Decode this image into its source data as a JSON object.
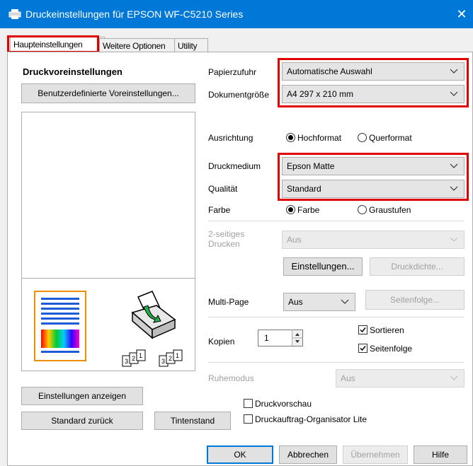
{
  "window": {
    "title": "Druckeinstellungen für EPSON WF-C5210 Series",
    "close_glyph": "✕"
  },
  "tabs": [
    {
      "label": "Haupteinstellungen"
    },
    {
      "label": "Weitere Optionen"
    },
    {
      "label": "Utility"
    }
  ],
  "left": {
    "presets_heading": "Druckvoreinstellungen",
    "custom_presets_button": "Benutzerdefinierte Voreinstellungen...",
    "show_settings_button": "Einstellungen anzeigen",
    "reset_button": "Standard zurück",
    "ink_button": "Tintenstand",
    "page_order_glyphs": [
      "1",
      "2",
      "3"
    ]
  },
  "form": {
    "paper_source": {
      "label": "Papierzufuhr",
      "value": "Automatische Auswahl"
    },
    "document_size": {
      "label": "Dokumentgröße",
      "value": "A4 297 x 210 mm"
    },
    "orientation": {
      "label": "Ausrichtung",
      "options": [
        "Hochformat",
        "Querformat"
      ],
      "selected": "Hochformat"
    },
    "media": {
      "label": "Druckmedium",
      "value": "Epson Matte"
    },
    "quality": {
      "label": "Qualität",
      "value": "Standard"
    },
    "color": {
      "label": "Farbe",
      "options": [
        "Farbe",
        "Graustufen"
      ],
      "selected": "Farbe"
    },
    "duplex": {
      "label_line1": "2-seitiges",
      "label_line2": "Drucken",
      "value": "Aus"
    },
    "settings_button": "Einstellungen...",
    "density_button": "Druckdichte...",
    "multipage": {
      "label": "Multi-Page",
      "value": "Aus"
    },
    "page_order_button": "Seitenfolge...",
    "copies": {
      "label": "Kopien",
      "value": "1"
    },
    "collate": {
      "label": "Sortieren",
      "checked": true
    },
    "reverse": {
      "label": "Seitenfolge",
      "checked": true
    },
    "quiet": {
      "label": "Ruhemodus",
      "value": "Aus"
    },
    "preview": {
      "label": "Druckvorschau",
      "checked": false
    },
    "organizer": {
      "label": "Druckauftrag-Organisator Lite",
      "checked": false
    }
  },
  "footer": {
    "ok": "OK",
    "cancel": "Abbrechen",
    "apply": "Übernehmen",
    "help": "Hilfe"
  },
  "colors": {
    "titlebar": "#0078d7",
    "highlight": "#e00000",
    "paper_lines": "#1e5bd8",
    "panel": "#ffffff"
  }
}
